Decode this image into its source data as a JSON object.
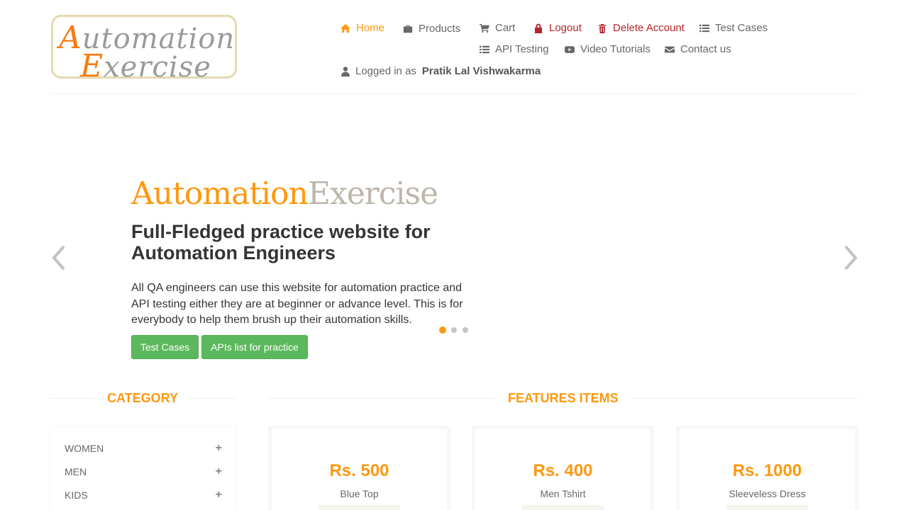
{
  "logo": {
    "line1_cap": "A",
    "line1_rest": "utomation",
    "line2_cap": "E",
    "line2_rest": "xercise"
  },
  "nav": {
    "home": "Home",
    "products": "Products",
    "cart": "Cart",
    "logout": "Logout",
    "delete_account": "Delete Account",
    "test_cases": "Test Cases",
    "api_testing": "API Testing",
    "video_tutorials": "Video Tutorials",
    "contact_us": "Contact us",
    "logged_in_prefix": "Logged in as",
    "user_name": "Pratik Lal Vishwakarma"
  },
  "hero": {
    "brand_part1": "Automation",
    "brand_part2": "Exercise",
    "title": "Full-Fledged practice website for Automation Engineers",
    "text": "All QA engineers can use this website for automation practice and API testing either they are at beginner or advance level. This is for everybody to help them brush up their automation skills.",
    "btn_test_cases": "Test Cases",
    "btn_apis": "APIs list for practice",
    "active_slide": 1,
    "slide_count": 3
  },
  "category": {
    "title": "CATEGORY",
    "items": [
      {
        "label": "WOMEN",
        "toggle": "+"
      },
      {
        "label": "MEN",
        "toggle": "+"
      },
      {
        "label": "KIDS",
        "toggle": "+"
      }
    ]
  },
  "features": {
    "title": "FEATURES ITEMS",
    "products": [
      {
        "price": "Rs. 500",
        "name": "Blue Top"
      },
      {
        "price": "Rs. 400",
        "name": "Men Tshirt"
      },
      {
        "price": "Rs. 1000",
        "name": "Sleeveless Dress"
      }
    ]
  },
  "colors": {
    "accent": "#FE980F",
    "danger": "#B3262D",
    "button_green": "#5CB85C",
    "text": "#696763"
  }
}
